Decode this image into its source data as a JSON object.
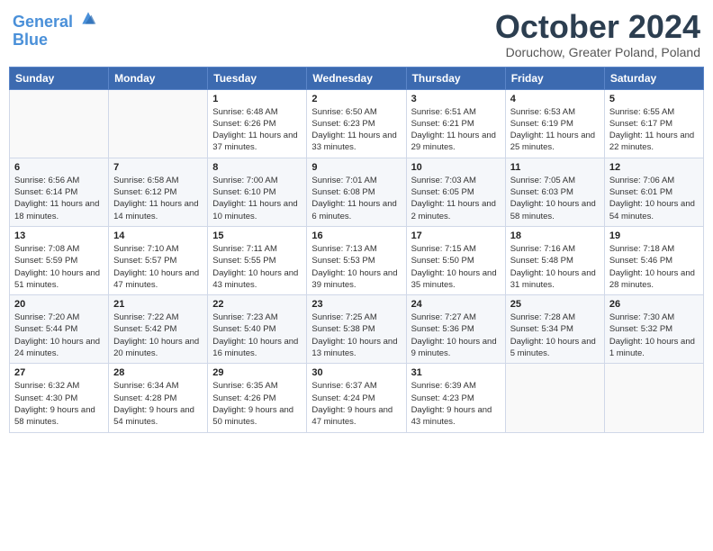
{
  "header": {
    "logo_line1": "General",
    "logo_line2": "Blue",
    "month": "October 2024",
    "location": "Doruchow, Greater Poland, Poland"
  },
  "weekdays": [
    "Sunday",
    "Monday",
    "Tuesday",
    "Wednesday",
    "Thursday",
    "Friday",
    "Saturday"
  ],
  "weeks": [
    [
      {
        "day": "",
        "info": ""
      },
      {
        "day": "",
        "info": ""
      },
      {
        "day": "1",
        "info": "Sunrise: 6:48 AM\nSunset: 6:26 PM\nDaylight: 11 hours and 37 minutes."
      },
      {
        "day": "2",
        "info": "Sunrise: 6:50 AM\nSunset: 6:23 PM\nDaylight: 11 hours and 33 minutes."
      },
      {
        "day": "3",
        "info": "Sunrise: 6:51 AM\nSunset: 6:21 PM\nDaylight: 11 hours and 29 minutes."
      },
      {
        "day": "4",
        "info": "Sunrise: 6:53 AM\nSunset: 6:19 PM\nDaylight: 11 hours and 25 minutes."
      },
      {
        "day": "5",
        "info": "Sunrise: 6:55 AM\nSunset: 6:17 PM\nDaylight: 11 hours and 22 minutes."
      }
    ],
    [
      {
        "day": "6",
        "info": "Sunrise: 6:56 AM\nSunset: 6:14 PM\nDaylight: 11 hours and 18 minutes."
      },
      {
        "day": "7",
        "info": "Sunrise: 6:58 AM\nSunset: 6:12 PM\nDaylight: 11 hours and 14 minutes."
      },
      {
        "day": "8",
        "info": "Sunrise: 7:00 AM\nSunset: 6:10 PM\nDaylight: 11 hours and 10 minutes."
      },
      {
        "day": "9",
        "info": "Sunrise: 7:01 AM\nSunset: 6:08 PM\nDaylight: 11 hours and 6 minutes."
      },
      {
        "day": "10",
        "info": "Sunrise: 7:03 AM\nSunset: 6:05 PM\nDaylight: 11 hours and 2 minutes."
      },
      {
        "day": "11",
        "info": "Sunrise: 7:05 AM\nSunset: 6:03 PM\nDaylight: 10 hours and 58 minutes."
      },
      {
        "day": "12",
        "info": "Sunrise: 7:06 AM\nSunset: 6:01 PM\nDaylight: 10 hours and 54 minutes."
      }
    ],
    [
      {
        "day": "13",
        "info": "Sunrise: 7:08 AM\nSunset: 5:59 PM\nDaylight: 10 hours and 51 minutes."
      },
      {
        "day": "14",
        "info": "Sunrise: 7:10 AM\nSunset: 5:57 PM\nDaylight: 10 hours and 47 minutes."
      },
      {
        "day": "15",
        "info": "Sunrise: 7:11 AM\nSunset: 5:55 PM\nDaylight: 10 hours and 43 minutes."
      },
      {
        "day": "16",
        "info": "Sunrise: 7:13 AM\nSunset: 5:53 PM\nDaylight: 10 hours and 39 minutes."
      },
      {
        "day": "17",
        "info": "Sunrise: 7:15 AM\nSunset: 5:50 PM\nDaylight: 10 hours and 35 minutes."
      },
      {
        "day": "18",
        "info": "Sunrise: 7:16 AM\nSunset: 5:48 PM\nDaylight: 10 hours and 31 minutes."
      },
      {
        "day": "19",
        "info": "Sunrise: 7:18 AM\nSunset: 5:46 PM\nDaylight: 10 hours and 28 minutes."
      }
    ],
    [
      {
        "day": "20",
        "info": "Sunrise: 7:20 AM\nSunset: 5:44 PM\nDaylight: 10 hours and 24 minutes."
      },
      {
        "day": "21",
        "info": "Sunrise: 7:22 AM\nSunset: 5:42 PM\nDaylight: 10 hours and 20 minutes."
      },
      {
        "day": "22",
        "info": "Sunrise: 7:23 AM\nSunset: 5:40 PM\nDaylight: 10 hours and 16 minutes."
      },
      {
        "day": "23",
        "info": "Sunrise: 7:25 AM\nSunset: 5:38 PM\nDaylight: 10 hours and 13 minutes."
      },
      {
        "day": "24",
        "info": "Sunrise: 7:27 AM\nSunset: 5:36 PM\nDaylight: 10 hours and 9 minutes."
      },
      {
        "day": "25",
        "info": "Sunrise: 7:28 AM\nSunset: 5:34 PM\nDaylight: 10 hours and 5 minutes."
      },
      {
        "day": "26",
        "info": "Sunrise: 7:30 AM\nSunset: 5:32 PM\nDaylight: 10 hours and 1 minute."
      }
    ],
    [
      {
        "day": "27",
        "info": "Sunrise: 6:32 AM\nSunset: 4:30 PM\nDaylight: 9 hours and 58 minutes."
      },
      {
        "day": "28",
        "info": "Sunrise: 6:34 AM\nSunset: 4:28 PM\nDaylight: 9 hours and 54 minutes."
      },
      {
        "day": "29",
        "info": "Sunrise: 6:35 AM\nSunset: 4:26 PM\nDaylight: 9 hours and 50 minutes."
      },
      {
        "day": "30",
        "info": "Sunrise: 6:37 AM\nSunset: 4:24 PM\nDaylight: 9 hours and 47 minutes."
      },
      {
        "day": "31",
        "info": "Sunrise: 6:39 AM\nSunset: 4:23 PM\nDaylight: 9 hours and 43 minutes."
      },
      {
        "day": "",
        "info": ""
      },
      {
        "day": "",
        "info": ""
      }
    ]
  ]
}
